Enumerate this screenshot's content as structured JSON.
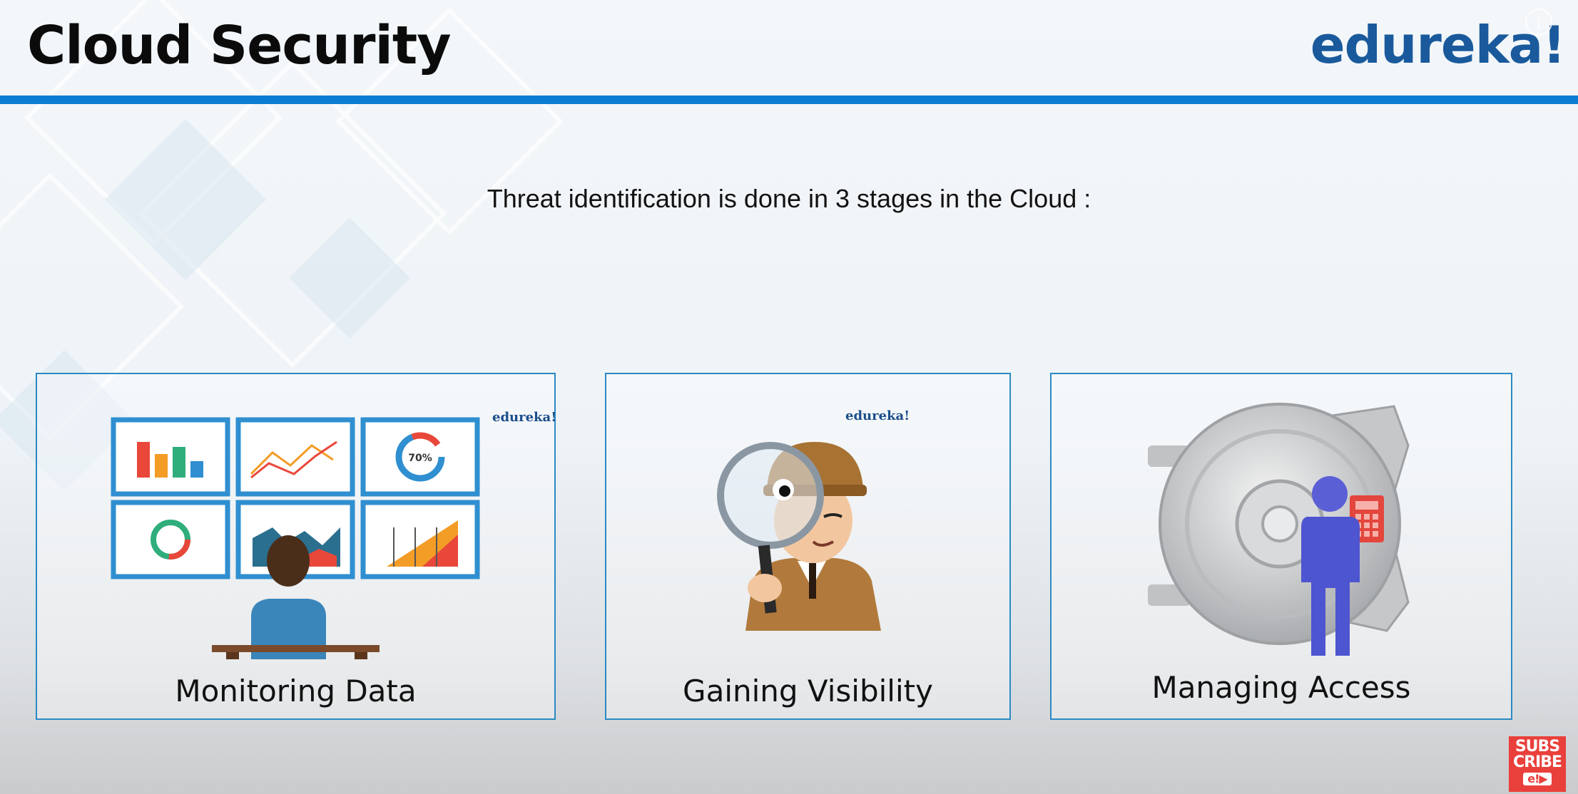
{
  "slide": {
    "title": "Cloud Security",
    "brand": "edureka!",
    "info_glyph": "i",
    "intro": "Threat identification is done in 3 stages in the Cloud :"
  },
  "stages": [
    {
      "label": "Monitoring Data",
      "watermark": "edureka!",
      "illustration": "monitoring-dashboard-illustration",
      "gauge_text": "70%"
    },
    {
      "label": "Gaining Visibility",
      "watermark": "edureka!",
      "illustration": "detective-magnifier-illustration"
    },
    {
      "label": "Managing Access",
      "illustration": "vault-access-illustration"
    }
  ],
  "subscribe": {
    "line1": "SUBS",
    "line2": "CRIBE",
    "logo": "e!▶"
  },
  "colors": {
    "accent": "#0c7dd3",
    "brand": "#1a5a9c",
    "card_border": "#2a8ac3",
    "subscribe": "#e9403b"
  }
}
